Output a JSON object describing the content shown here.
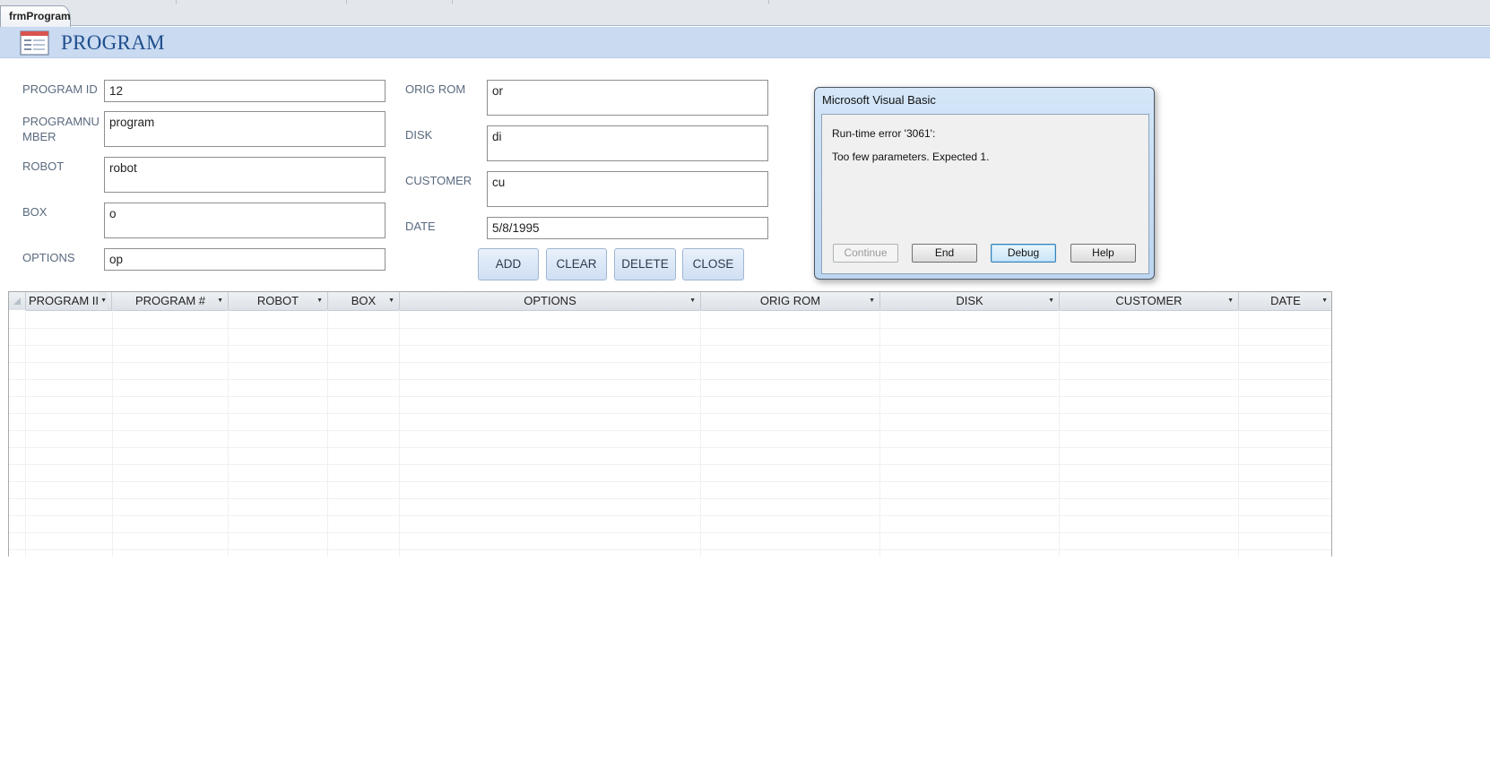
{
  "document_tab": {
    "label": "frmProgram"
  },
  "header": {
    "title": "PROGRAM",
    "icon": "form-icon"
  },
  "form": {
    "left_fields": [
      {
        "label": "PROGRAM ID",
        "value": "12"
      },
      {
        "label": "PROGRAMNU\nMBER",
        "value": "program"
      },
      {
        "label": "ROBOT",
        "value": "robot"
      },
      {
        "label": "BOX",
        "value": "o"
      },
      {
        "label": "OPTIONS",
        "value": "op"
      }
    ],
    "right_fields": [
      {
        "label": "ORIG ROM",
        "value": "or"
      },
      {
        "label": "DISK",
        "value": "di"
      },
      {
        "label": "CUSTOMER",
        "value": "cu"
      },
      {
        "label": "DATE",
        "value": "5/8/1995"
      }
    ],
    "buttons": {
      "add": "ADD",
      "clear": "CLEAR",
      "delete": "DELETE",
      "close": "CLOSE"
    }
  },
  "datasheet": {
    "columns": [
      "PROGRAM II",
      "PROGRAM #",
      "ROBOT",
      "BOX",
      "OPTIONS",
      "ORIG ROM",
      "DISK",
      "CUSTOMER",
      "DATE"
    ],
    "rows": []
  },
  "dialog": {
    "title": "Microsoft Visual Basic",
    "error_line": "Run-time error '3061':",
    "message": "Too few parameters. Expected 1.",
    "buttons": {
      "continue": "Continue",
      "end": "End",
      "debug": "Debug",
      "help": "Help"
    }
  }
}
